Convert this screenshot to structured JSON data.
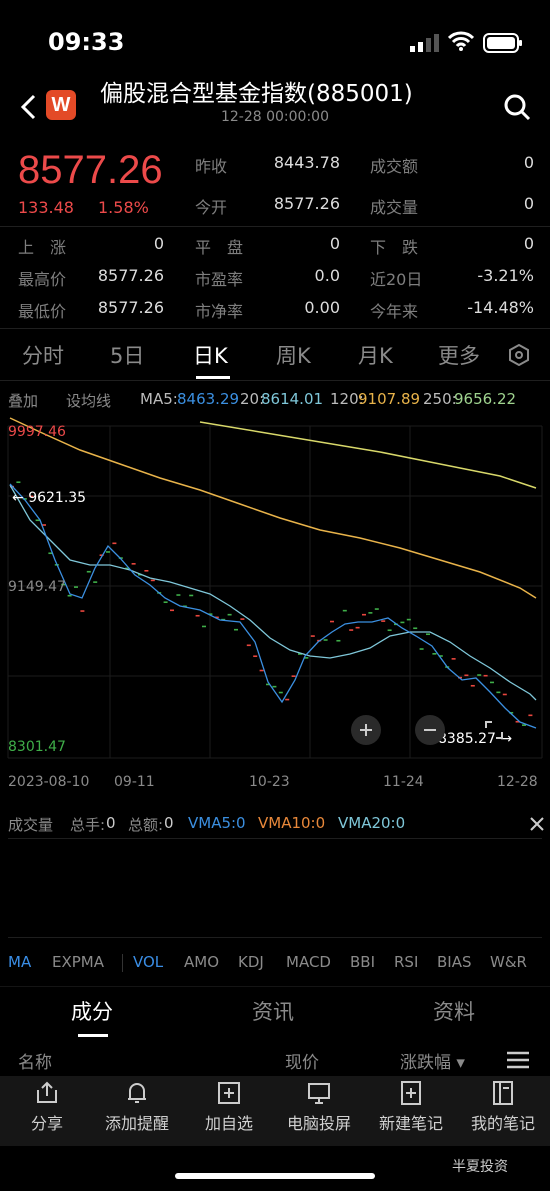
{
  "status": {
    "time": "09:33"
  },
  "header": {
    "logo_letter": "W",
    "title": "偏股混合型基金指数(885001)",
    "subtitle": "12-28 00:00:00"
  },
  "quote": {
    "price": "8577.26",
    "change": "133.48",
    "change_pct": "1.58%",
    "fields": {
      "prev_close_label": "昨收",
      "prev_close": "8443.78",
      "turnover_label": "成交额",
      "turnover": "0",
      "open_label": "今开",
      "open": "8577.26",
      "volume_label": "成交量",
      "volume": "0",
      "up_label": "上　涨",
      "up": "0",
      "flat_label": "平　盘",
      "flat": "0",
      "down_label": "下　跌",
      "down": "0",
      "high_label": "最高价",
      "high": "8577.26",
      "pe_label": "市盈率",
      "pe": "0.0",
      "d20_label": "近20日",
      "d20": "-3.21%",
      "low_label": "最低价",
      "low": "8577.26",
      "pb_label": "市净率",
      "pb": "0.00",
      "ytd_label": "今年来",
      "ytd": "-14.48%"
    }
  },
  "tabs": [
    "分时",
    "5日",
    "日K",
    "周K",
    "月K",
    "更多"
  ],
  "active_tab": "日K",
  "ma_bar": {
    "overlay": "叠加",
    "set_ma": "设均线",
    "ma5_label": "MA5:",
    "ma5": "8463.29",
    "ma20_label": "20:",
    "ma20": "8614.01",
    "ma120_label": "120:",
    "ma120": "9107.89",
    "ma250_label": "250:",
    "ma250": "9656.22"
  },
  "chart_data": {
    "type": "candlestick",
    "y_high_label": "9997.46",
    "y_mid_label": "9149.47",
    "y_low_label": "8301.47",
    "high_marker": "9621.35",
    "low_marker": "8385.27",
    "x_labels": [
      "2023-08-10",
      "09-11",
      "10-23",
      "11-24",
      "12-28"
    ],
    "ylim": [
      8301.47,
      9997.46
    ],
    "colors": {
      "up": "#e8463e",
      "down": "#3fae49",
      "ma5": "#3b8fe0",
      "ma20": "#7fc7d9",
      "ma120": "#e8b34a",
      "ma250": "#d8d86a"
    }
  },
  "volume": {
    "label": "成交量",
    "total_hand_label": "总手:",
    "total_hand": "0",
    "total_amt_label": "总额:",
    "total_amt": "0",
    "vma5": "VMA5:0",
    "vma10": "VMA10:0",
    "vma20": "VMA20:0"
  },
  "indicators": [
    "MA",
    "EXPMA",
    "VOL",
    "AMO",
    "KDJ",
    "MACD",
    "BBI",
    "RSI",
    "BIAS",
    "W&R"
  ],
  "section_tabs": [
    "成分",
    "资讯",
    "资料"
  ],
  "table_header": {
    "name": "名称",
    "price": "现价",
    "change": "涨跌幅"
  },
  "bottom_bar": [
    "分享",
    "添加提醒",
    "加自选",
    "电脑投屏",
    "新建笔记",
    "我的笔记"
  ],
  "watermark": "半夏投资"
}
